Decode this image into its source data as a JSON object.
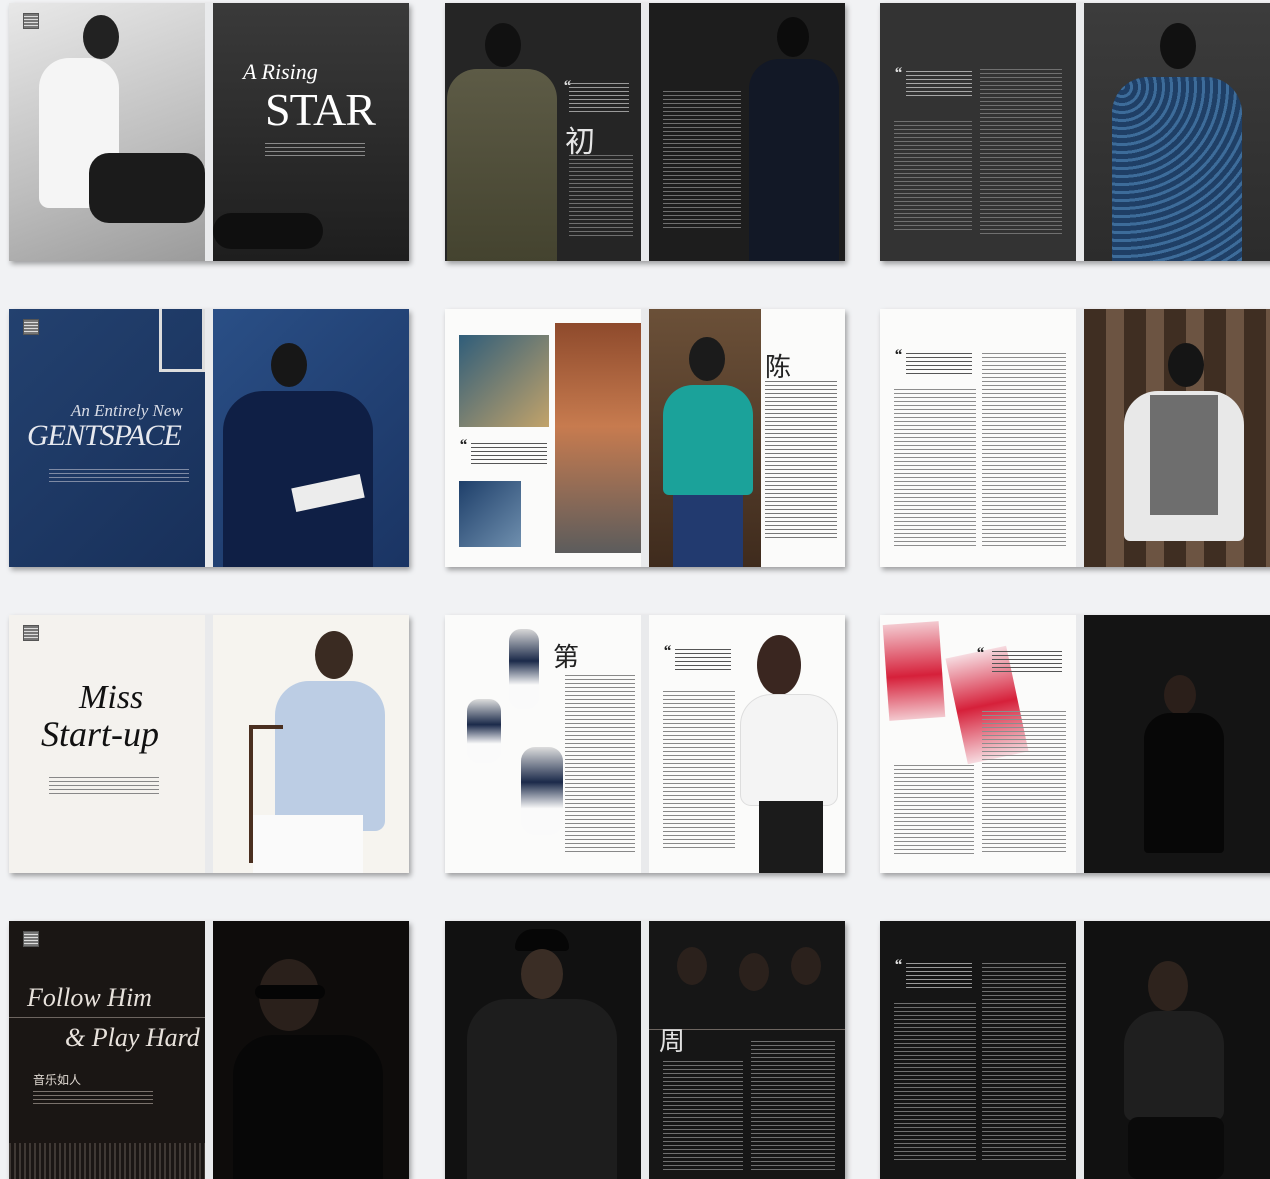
{
  "spreads": [
    {
      "title_line1": "A Rising",
      "title_line2": "STAR"
    },
    {
      "dropcap": "初"
    },
    {},
    {
      "title_line1": "An Entirely New",
      "title_line2": "GENTSPACE"
    },
    {
      "dropcap": "陈"
    },
    {},
    {
      "title_line1": "Miss",
      "title_line2": "Start-up"
    },
    {
      "dropcap": "第"
    },
    {},
    {
      "title_line1": "Follow Him",
      "title_line2": "& Play Hard",
      "subtitle": "音乐如人"
    },
    {
      "dropcap": "周"
    },
    {}
  ]
}
